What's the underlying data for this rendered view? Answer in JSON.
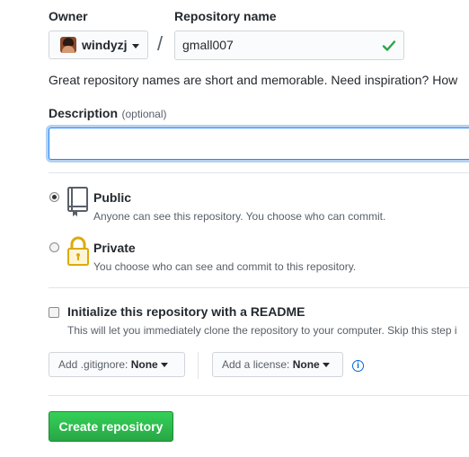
{
  "owner": {
    "label": "Owner",
    "value": "windyzj"
  },
  "repo": {
    "label": "Repository name",
    "value": "gmall007",
    "separator": "/"
  },
  "hint": "Great repository names are short and memorable. Need inspiration? How",
  "description": {
    "label": "Description",
    "optional": "(optional)",
    "value": ""
  },
  "visibility": {
    "public": {
      "title": "Public",
      "desc": "Anyone can see this repository. You choose who can commit."
    },
    "private": {
      "title": "Private",
      "desc": "You choose who can see and commit to this repository."
    }
  },
  "init": {
    "label": "Initialize this repository with a README",
    "desc": "This will let you immediately clone the repository to your computer. Skip this step i"
  },
  "gitignore": {
    "prefix": "Add .gitignore:",
    "value": "None"
  },
  "license": {
    "prefix": "Add a license:",
    "value": "None"
  },
  "info_icon": "i",
  "create_button": "Create repository",
  "colors": {
    "accent": "#28a745",
    "link": "#0366d6",
    "check": "#28a745"
  }
}
